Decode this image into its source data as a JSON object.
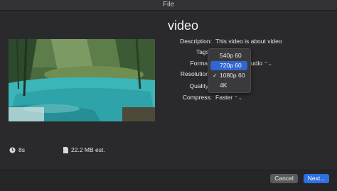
{
  "window": {
    "title": "File"
  },
  "video": {
    "title": "video"
  },
  "fields": {
    "description": {
      "label": "Description:",
      "value": "This video is about video"
    },
    "tags": {
      "label": "Tags"
    },
    "format": {
      "label": "Forma",
      "value_tail": "udio"
    },
    "resolution": {
      "label": "Resolution"
    },
    "quality": {
      "label": "Quality"
    },
    "compress": {
      "label": "Compress:",
      "value": "Faster"
    }
  },
  "resolution_menu": {
    "items": [
      {
        "label": "540p 60",
        "checked": false,
        "highlighted": false
      },
      {
        "label": "720p 60",
        "checked": false,
        "highlighted": true
      },
      {
        "label": "1080p 60",
        "checked": true,
        "highlighted": false
      },
      {
        "label": "4K",
        "checked": false,
        "highlighted": false
      }
    ]
  },
  "stats": {
    "duration": "8s",
    "size": "22.2 MB est."
  },
  "buttons": {
    "cancel": "Cancel",
    "next": "Next..."
  },
  "colors": {
    "accent": "#2f66d0",
    "next_button": "#2f6fe0"
  }
}
